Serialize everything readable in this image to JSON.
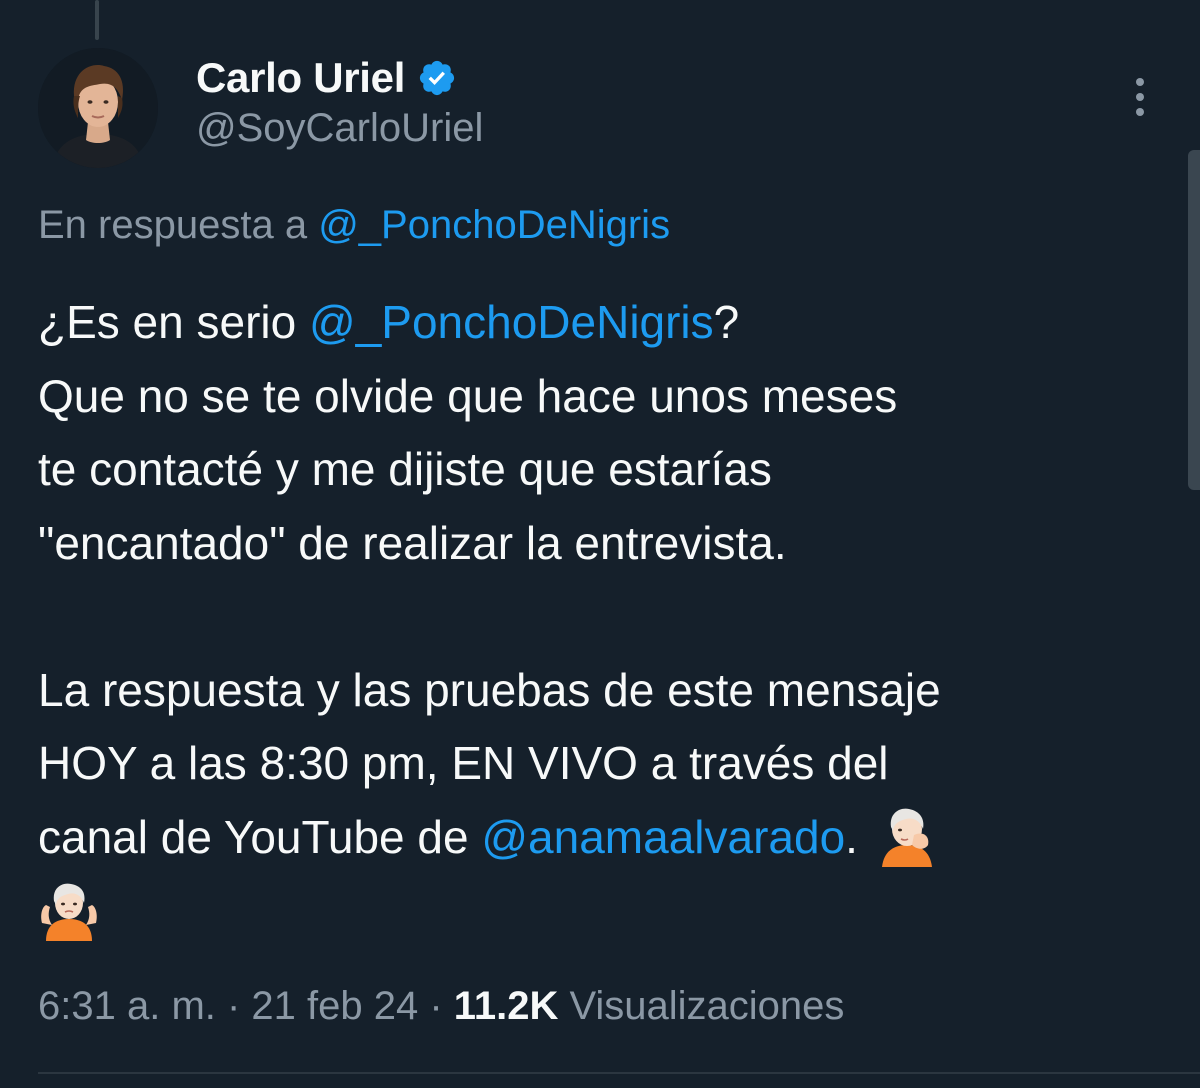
{
  "author": {
    "display_name": "Carlo Uriel",
    "handle": "@SoyCarloUriel",
    "verified": true,
    "avatar_icon": "profile-photo"
  },
  "reply_context": {
    "prefix": "En respuesta a",
    "mention": "@_PonchoDeNigris"
  },
  "tweet": {
    "p1_l1_pre": "¿Es en serio ",
    "p1_l1_mention": "@_PonchoDeNigris",
    "p1_l1_post": "?",
    "p1_l2": "Que no se te olvide que hace unos meses",
    "p1_l3": "te contacté y me dijiste que estarías",
    "p1_l4": "\"encantado\" de realizar la entrevista.",
    "p2_l1": "La respuesta y las pruebas de este mensaje",
    "p2_l2": "HOY a las 8:30 pm, EN VIVO a través del",
    "p2_l3_pre": "canal de YouTube de ",
    "p2_l3_mention": "@anamaalvarado",
    "p2_l3_post": ".",
    "emojis": [
      "face-palm-emoji",
      "shrug-emoji"
    ]
  },
  "meta": {
    "time": "6:31 a. m.",
    "sep1": " · ",
    "date": "21 feb 24",
    "sep2": " · ",
    "views_count": "11.2K",
    "views_label": " Visualizaciones"
  },
  "colors": {
    "background": "#15202b",
    "primary_text": "#f7f9f9",
    "secondary_text": "#8b98a5",
    "link": "#1d9bf0",
    "verified_badge": "#1d9bf0"
  }
}
